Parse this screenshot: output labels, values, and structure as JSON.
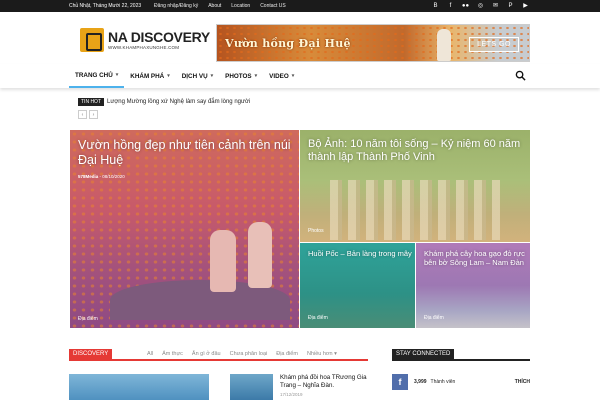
{
  "topbar": {
    "date": "Chủ Nhật, Tháng Mười 22, 2023",
    "menu": [
      "Đăng nhập/Đăng ký",
      "About",
      "Location",
      "Contact US"
    ],
    "socials": [
      "blogger-icon",
      "facebook-icon",
      "flickr-icon",
      "instagram-icon",
      "email-icon",
      "pinterest-icon",
      "youtube-icon"
    ]
  },
  "header": {
    "logo_title": "NA DISCOVERY",
    "logo_sub": "WWW.KHAMPHAXUNGHE.COM",
    "banner_text": "Vườn hồng Đại Huệ",
    "banner_button": "LETS GO"
  },
  "nav": {
    "items": [
      "TRANG CHỦ",
      "KHÁM PHÁ",
      "DỊCH VỤ",
      "PHOTOS",
      "VIDEO"
    ]
  },
  "ticker": {
    "label": "TIN HOT",
    "text": "Lượng Mường lồng xứ Nghệ làm say đắm lòng người"
  },
  "tiles": [
    {
      "title": "Vườn hồng đẹp như tiên cảnh trên núi Đại Huệ",
      "author": "578Media",
      "date": "08/10/2020",
      "category": "Địa điểm"
    },
    {
      "title": "Bộ Ảnh: 10 năm tôi sống – Kỷ niệm 60 năm thành lập Thành Phố Vinh",
      "category": "Photos"
    },
    {
      "title": "Huồi Pốc – Bản làng trong mây",
      "category": "Địa điểm"
    },
    {
      "title": "Khám phá cây hoa gạo đỏ rực bên bờ Sông Lam – Nam Đàn",
      "category": "Địa điểm"
    }
  ],
  "discovery": {
    "tag": "DISCOVERY",
    "filters": [
      "All",
      "Ẩm thực",
      "Ăn gì ở đâu",
      "Chưa phân loại",
      "Địa điểm",
      "Nhiều hơn"
    ],
    "post_title": "Khám phá đồi hoa TRương Gia Trang – Nghĩa Đàn.",
    "post_date": "17/12/2019"
  },
  "stay": {
    "tag": "STAY CONNECTED",
    "fb_count": "3,999",
    "fb_label": "Thành viên",
    "fb_like": "THÍCH"
  },
  "colors": {
    "accent": "#4db2ec",
    "discovery": "#e53935",
    "facebook": "#516eab"
  }
}
